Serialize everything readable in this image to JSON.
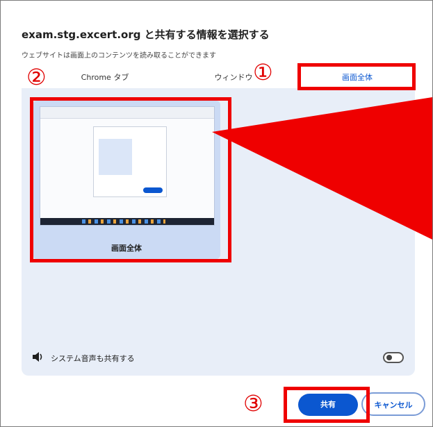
{
  "dialog": {
    "title": "exam.stg.excert.org と共有する情報を選択する",
    "subtitle": "ウェブサイトは画面上のコンテンツを読み取ることができます"
  },
  "tabs": [
    {
      "label": "Chrome タブ",
      "active": false
    },
    {
      "label": "ウィンドウ",
      "active": false
    },
    {
      "label": "画面全体",
      "active": true
    }
  ],
  "screen_card": {
    "label": "画面全体"
  },
  "audio": {
    "label": "システム音声も共有する",
    "enabled": false
  },
  "buttons": {
    "share": "共有",
    "cancel": "キャンセル"
  },
  "annotations": {
    "step1": "①",
    "step2": "②",
    "step3": "③",
    "color": "#ef0000"
  },
  "colors": {
    "accent": "#0b57d0",
    "panel": "#e8eef8",
    "card": "#cbdaf4"
  }
}
